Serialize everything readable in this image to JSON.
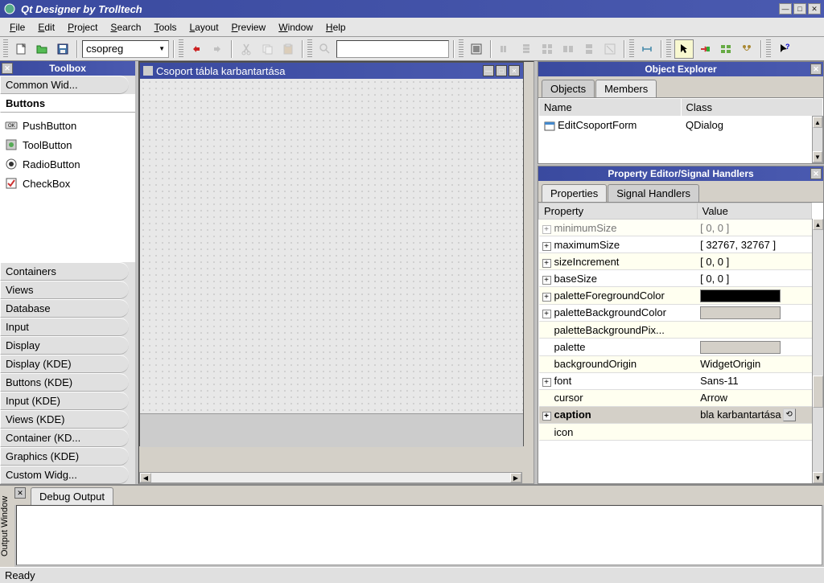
{
  "window": {
    "title": "Qt Designer by Trolltech"
  },
  "menu": {
    "file": "File",
    "edit": "Edit",
    "project": "Project",
    "search": "Search",
    "tools": "Tools",
    "layout": "Layout",
    "preview": "Preview",
    "window": "Window",
    "help": "Help"
  },
  "toolbar": {
    "combo_value": "csopreg"
  },
  "toolbox": {
    "title": "Toolbox",
    "categories": [
      "Common Wid...",
      "Buttons",
      "Containers",
      "Views",
      "Database",
      "Input",
      "Display",
      "Display (KDE)",
      "Buttons (KDE)",
      "Input (KDE)",
      "Views (KDE)",
      "Container (KD...",
      "Graphics (KDE)",
      "Custom Widg..."
    ],
    "active_index": 1,
    "buttons_items": [
      "PushButton",
      "ToolButton",
      "RadioButton",
      "CheckBox"
    ]
  },
  "form": {
    "title": "Csoport tábla karbantartása"
  },
  "obj_explorer": {
    "title": "Object Explorer",
    "tabs": [
      "Objects",
      "Members"
    ],
    "active_tab": 1,
    "headers": [
      "Name",
      "Class"
    ],
    "rows": [
      {
        "name": "EditCsoportForm",
        "class": "QDialog"
      }
    ]
  },
  "prop_editor": {
    "title": "Property Editor/Signal Handlers",
    "tabs": [
      "Properties",
      "Signal Handlers"
    ],
    "active_tab": 0,
    "headers": [
      "Property",
      "Value"
    ],
    "rows": [
      {
        "prop": "minimumSize",
        "value": "[ 0, 0 ]",
        "exp": true,
        "cut": true
      },
      {
        "prop": "maximumSize",
        "value": "[ 32767, 32767 ]",
        "exp": true
      },
      {
        "prop": "sizeIncrement",
        "value": "[ 0, 0 ]",
        "exp": true
      },
      {
        "prop": "baseSize",
        "value": "[ 0, 0 ]",
        "exp": true
      },
      {
        "prop": "paletteForegroundColor",
        "value": "",
        "exp": true,
        "swatch": "black"
      },
      {
        "prop": "paletteBackgroundColor",
        "value": "",
        "exp": true,
        "swatch": "gray"
      },
      {
        "prop": "paletteBackgroundPix...",
        "value": "",
        "indent": true
      },
      {
        "prop": "palette",
        "value": "",
        "indent": true,
        "swatch": "gray"
      },
      {
        "prop": "backgroundOrigin",
        "value": "WidgetOrigin",
        "indent": true
      },
      {
        "prop": "font",
        "value": "Sans-11",
        "exp": true
      },
      {
        "prop": "cursor",
        "value": "Arrow",
        "indent": true
      },
      {
        "prop": "caption",
        "value": "bla karbantartása",
        "exp": true,
        "sel": true
      },
      {
        "prop": "icon",
        "value": "",
        "indent": true
      }
    ]
  },
  "debug": {
    "tab": "Debug Output",
    "side": "Output Window"
  },
  "status": {
    "text": "Ready"
  }
}
